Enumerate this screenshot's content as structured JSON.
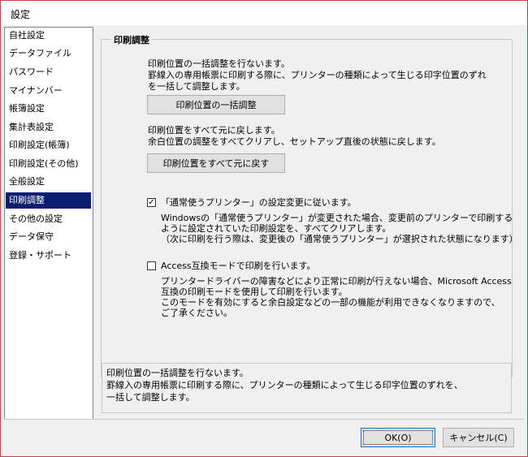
{
  "window": {
    "title": "設定"
  },
  "sidebar": {
    "items": [
      {
        "label": "自社設定",
        "selected": false
      },
      {
        "label": "データファイル",
        "selected": false
      },
      {
        "label": "パスワード",
        "selected": false
      },
      {
        "label": "マイナンバー",
        "selected": false
      },
      {
        "label": "帳簿設定",
        "selected": false
      },
      {
        "label": "集計表設定",
        "selected": false
      },
      {
        "label": "印刷設定(帳簿)",
        "selected": false
      },
      {
        "label": "印刷設定(その他)",
        "selected": false
      },
      {
        "label": "全般設定",
        "selected": false
      },
      {
        "label": "印刷調整",
        "selected": true
      },
      {
        "label": "その他の設定",
        "selected": false
      },
      {
        "label": "データ保守",
        "selected": false
      },
      {
        "label": "登録・サポート",
        "selected": false
      }
    ]
  },
  "main": {
    "group_title": "印刷調整",
    "adjust_desc": [
      "印刷位置の一括調整を行ないます。",
      "罫線入の専用帳票に印刷する際に、プリンターの種類によって生じる印字位置のずれ",
      "を一括して調整します。"
    ],
    "adjust_button": "印刷位置の一括調整",
    "reset_desc": [
      "印刷位置をすべて元に戻します。",
      "余白位置の調整をすべてクリアし、セットアップ直後の状態に戻します。"
    ],
    "reset_button": "印刷位置をすべて元に戻す",
    "follow_default": {
      "checked": true,
      "mark": "✓",
      "label": "「通常使うプリンター」の設定変更に従います。",
      "desc": [
        "Windowsの「通常使うプリンター」が変更された場合、変更前のプリンターで印刷する",
        "ように設定されていた印刷設定を、すべてクリアします。",
        "（次に印刷を行う際は、変更後の「通常使うプリンター」が選択された状態になります）"
      ]
    },
    "access_mode": {
      "checked": false,
      "mark": "",
      "label": "Access互換モードで印刷を行います。",
      "desc": [
        "プリンタードライバーの障害などにより正常に印刷が行えない場合、Microsoft Access",
        "互換の印刷モードを使用して印刷を行います。",
        "このモードを有効にすると余白設定などの一部の機能が利用できなくなりますので、",
        "ご了承ください。"
      ]
    }
  },
  "description_panel": {
    "lines": [
      "印刷位置の一括調整を行ないます。",
      "罫線入の専用帳票に印刷する際に、プリンターの種類によって生じる印字位置のずれを、",
      "一括して調整します。"
    ]
  },
  "footer": {
    "ok_label": "OK(O)",
    "cancel_label": "キャンセル(C)"
  }
}
